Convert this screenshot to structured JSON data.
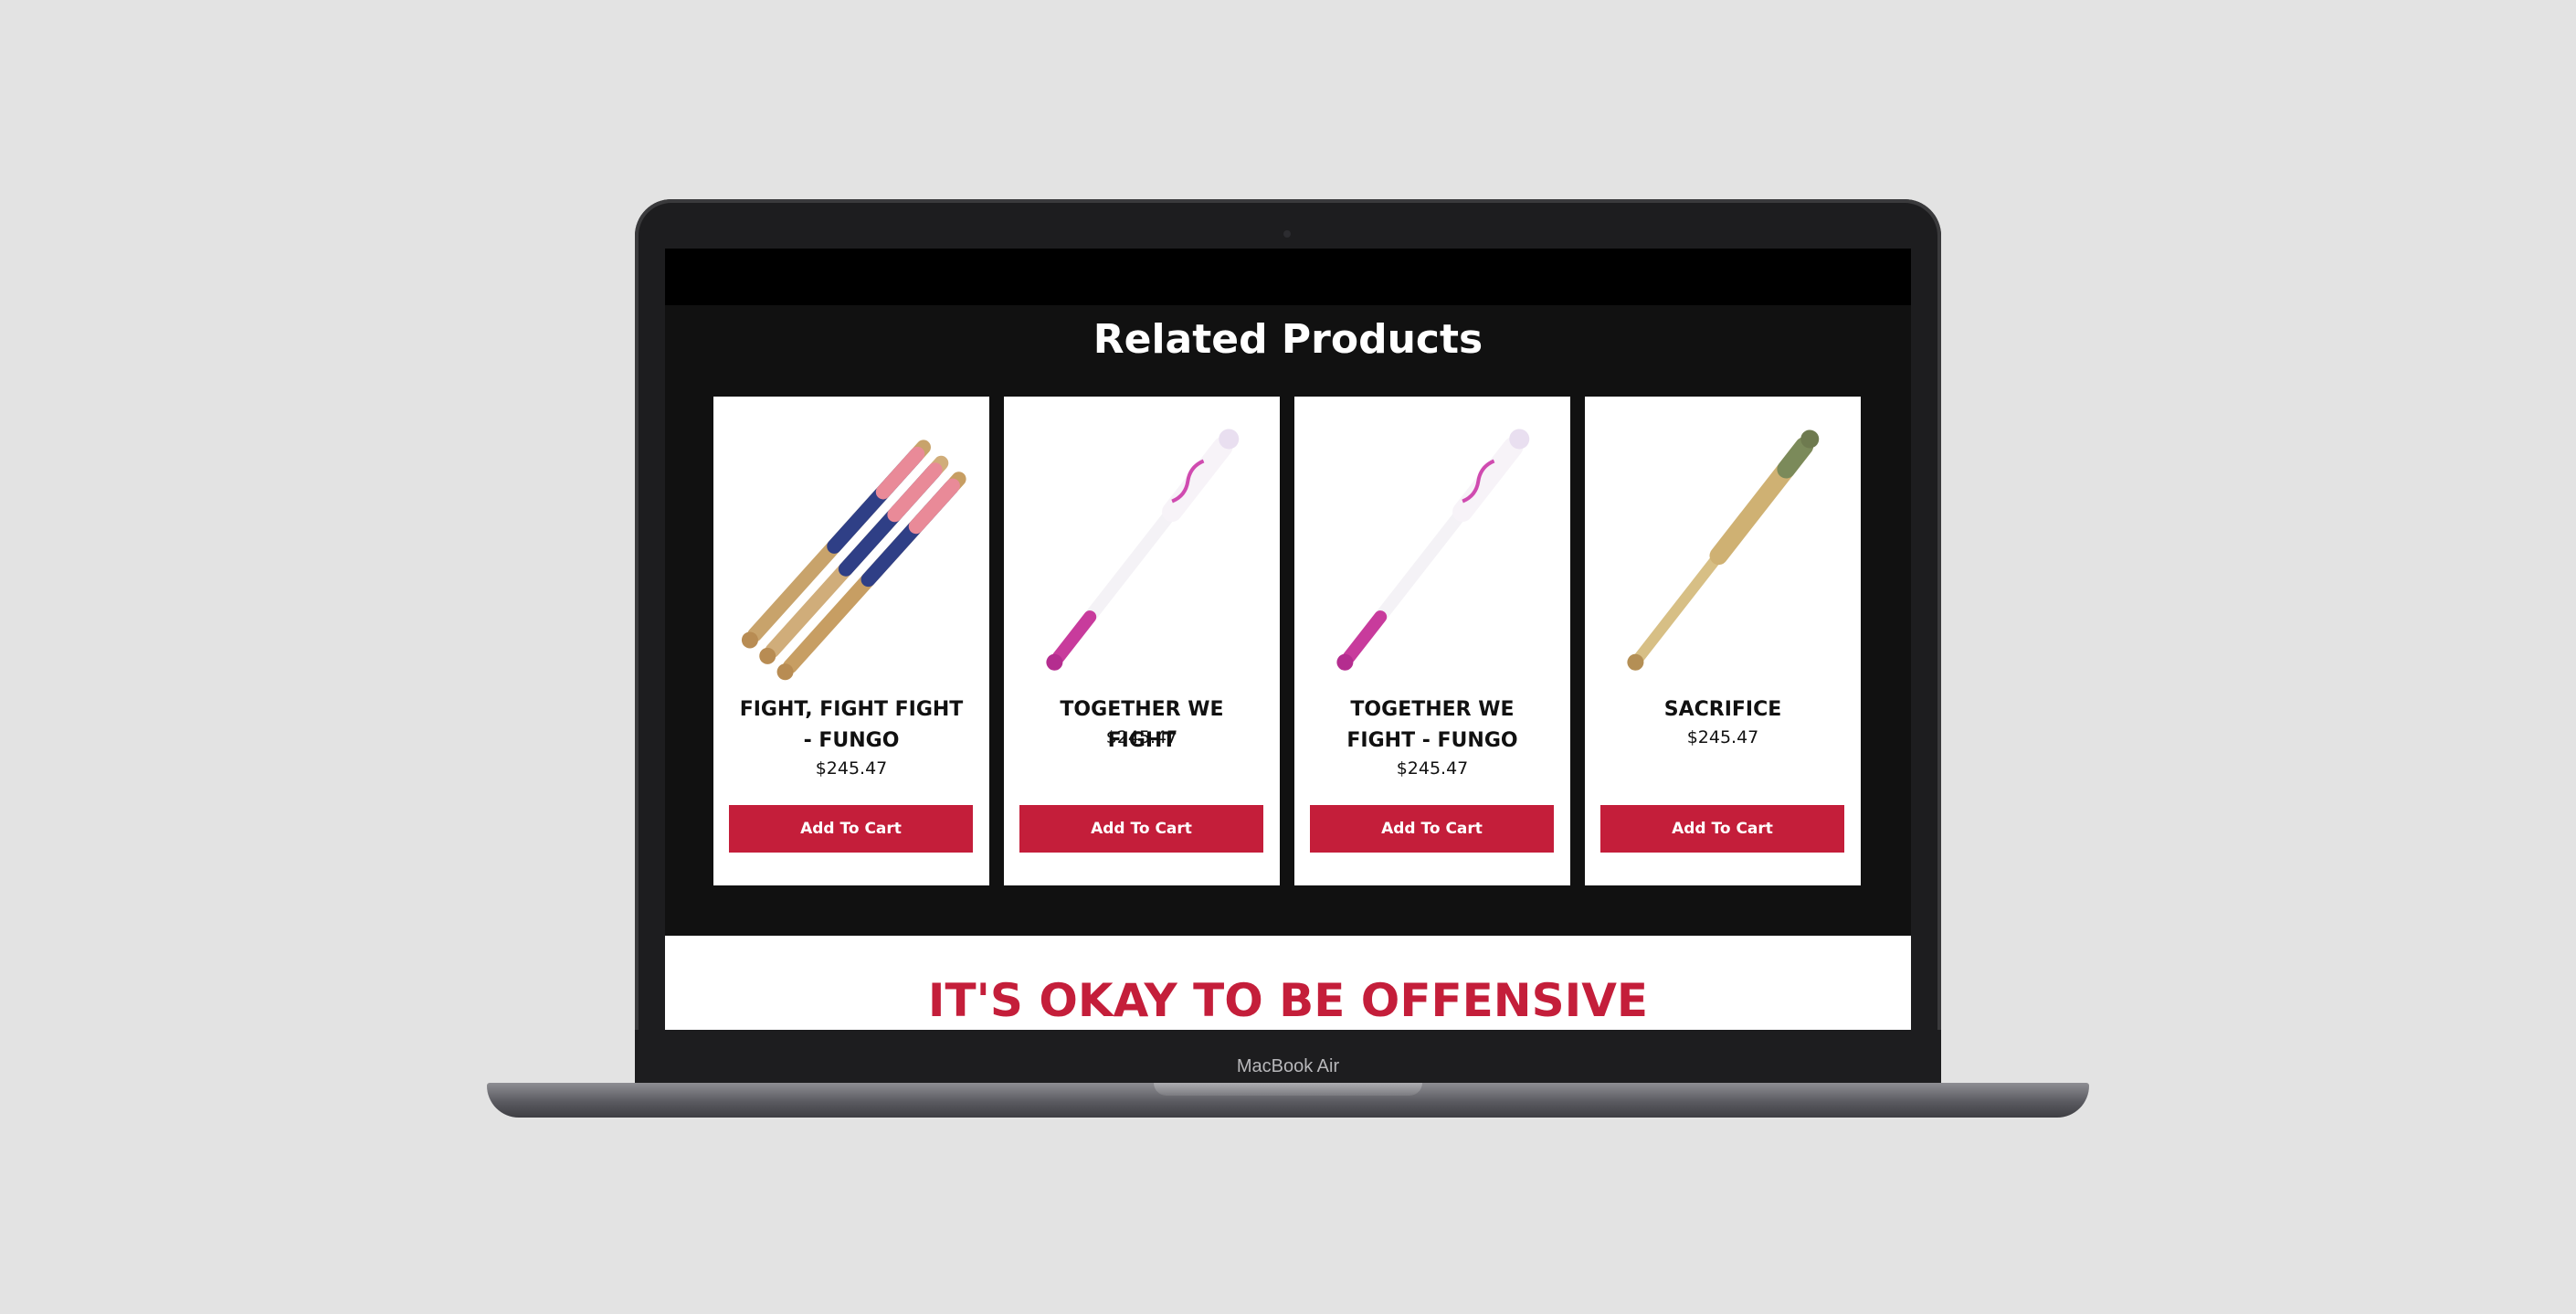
{
  "device": {
    "model_label": "MacBook Air"
  },
  "related": {
    "title": "Related Products",
    "products": [
      {
        "name": "FIGHT, FIGHT FIGHT - FUNGO",
        "price": "$245.47",
        "cta": "Add To Cart",
        "image": "bat-trio-red-white-blue-image"
      },
      {
        "name": "TOGETHER WE FIGHT",
        "price": "$245.47",
        "cta": "Add To Cart",
        "image": "bat-pink-white-image"
      },
      {
        "name": "TOGETHER WE FIGHT - FUNGO",
        "price": "$245.47",
        "cta": "Add To Cart",
        "image": "bat-pink-white-image"
      },
      {
        "name": "SACRIFICE",
        "price": "$245.47",
        "cta": "Add To Cart",
        "image": "bat-natural-wood-image"
      }
    ]
  },
  "banner": {
    "heading": "IT'S OKAY TO BE OFFENSIVE"
  },
  "colors": {
    "accent": "#c41e3a",
    "background_page": "#111111",
    "card": "#ffffff"
  }
}
